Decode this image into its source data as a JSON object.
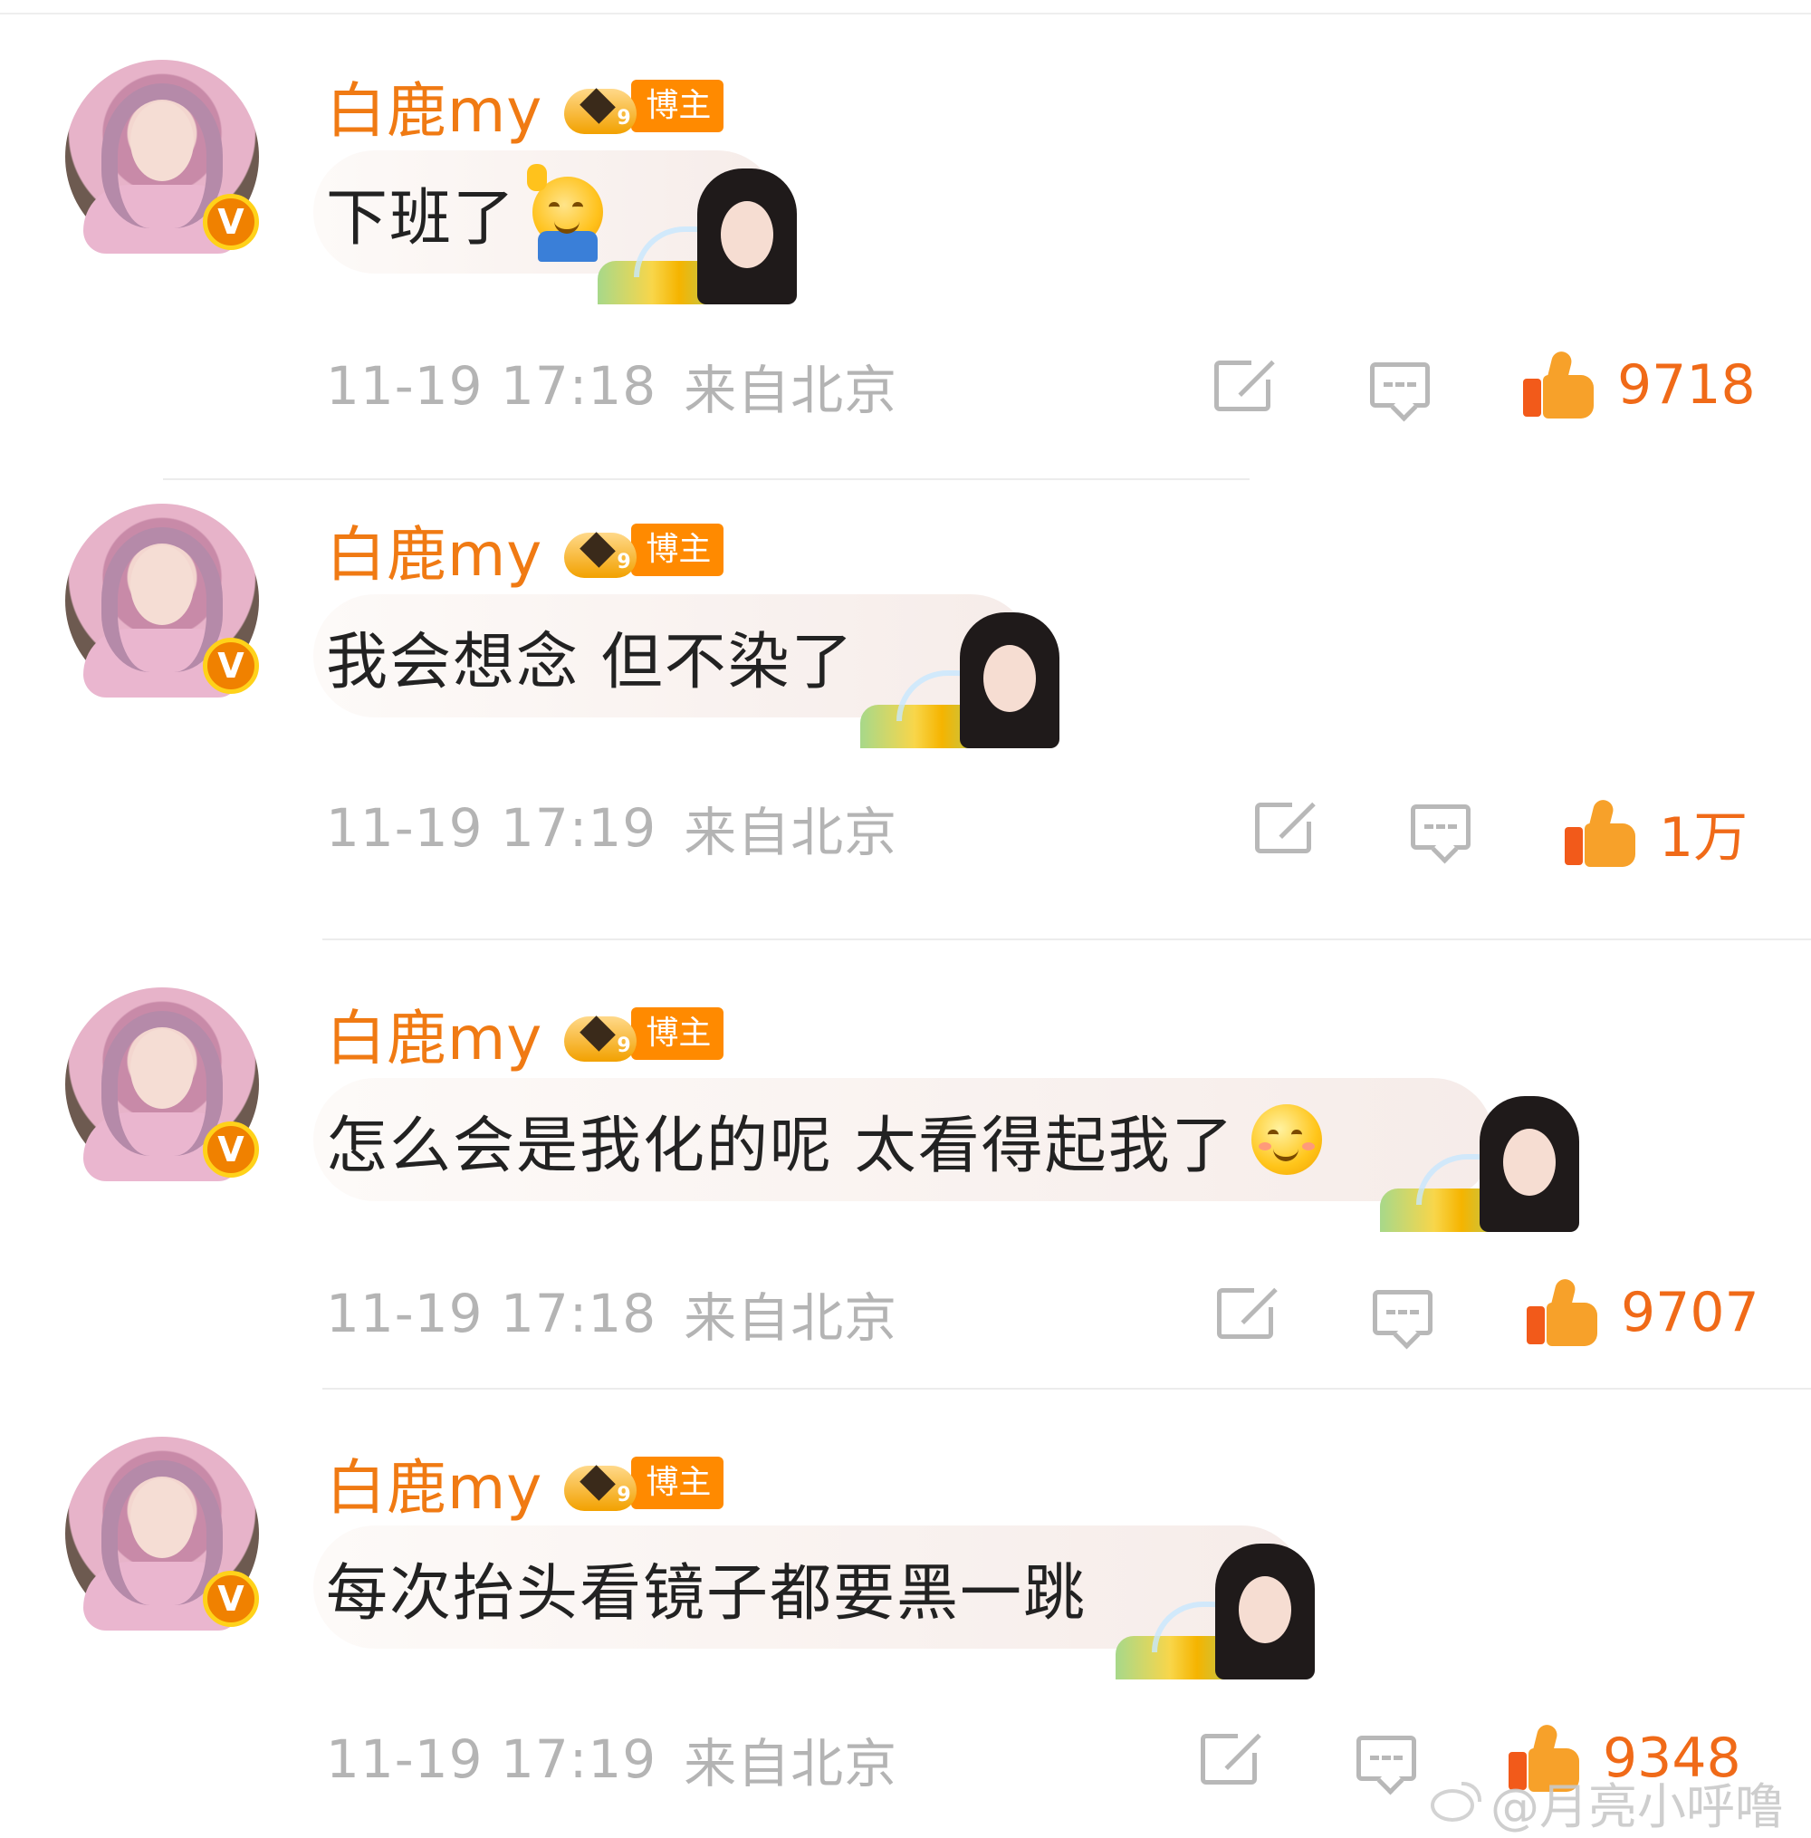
{
  "comments": [
    {
      "username": "白鹿my",
      "badge": {
        "level": "9",
        "label": "博主"
      },
      "text": "下班了",
      "emoji": "waving-emoji",
      "time": "11-19 17:18",
      "location": "来自北京",
      "likes": "9718"
    },
    {
      "username": "白鹿my",
      "badge": {
        "level": "9",
        "label": "博主"
      },
      "text": "我会想念 但不染了",
      "emoji": "",
      "time": "11-19 17:19",
      "location": "来自北京",
      "likes": "1万"
    },
    {
      "username": "白鹿my",
      "badge": {
        "level": "9",
        "label": "博主"
      },
      "text": "怎么会是我化的呢 太看得起我了",
      "emoji": "smiling-emoji",
      "time": "11-19 17:18",
      "location": "来自北京",
      "likes": "9707"
    },
    {
      "username": "白鹿my",
      "badge": {
        "level": "9",
        "label": "博主"
      },
      "text": "每次抬头看镜子都要黑一跳",
      "emoji": "",
      "time": "11-19 17:19",
      "location": "来自北京",
      "likes": "9348"
    }
  ],
  "verified_mark": "V",
  "watermark": "@月亮小呼噜",
  "colors": {
    "username": "#f07a13",
    "badge": "#ff8a00",
    "meta": "#b4b4b4",
    "like": "#f06a18",
    "text": "#222222"
  }
}
